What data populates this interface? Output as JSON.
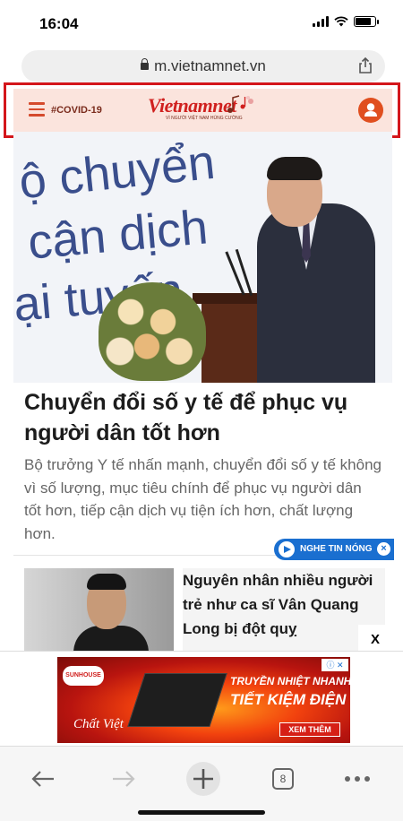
{
  "status_bar": {
    "time": "16:04"
  },
  "browser": {
    "url": "m.vietnamnet.vn",
    "tab_count": "8"
  },
  "site_header": {
    "tag": "#COVID-19",
    "logo_text": "Vietnamnet",
    "logo_tagline": "VÌ NGƯỜI VIỆT NAM HÙNG CƯỜNG"
  },
  "hero": {
    "bg_lines": [
      "ộ chuyển",
      "cận dịch",
      "ại tuyến"
    ]
  },
  "article_main": {
    "headline": "Chuyển đổi số y tế để phục vụ người dân tốt hơn",
    "summary": "Bộ trưởng Y tế nhấn mạnh, chuyển đổi số y tế không vì số lượng, mục tiêu chính để phục vụ người dân tốt hơn, tiếp cận dịch vụ tiện ích hơn, chất lượng hơn."
  },
  "hot_news": {
    "label": "NGHE TIN NÓNG",
    "close": "×"
  },
  "article_second": {
    "title": "Nguyên nhân nhiều người trẻ như ca sĩ Vân Quang Long bị đột quỵ"
  },
  "ad": {
    "close": "X",
    "brand": "SUNHOUSE",
    "line1": "TRUYỀN NHIỆT NHANH",
    "line2": "TIẾT KIỆM ĐIỆN",
    "button": "XEM THÊM",
    "signature": "Chất Việt"
  }
}
